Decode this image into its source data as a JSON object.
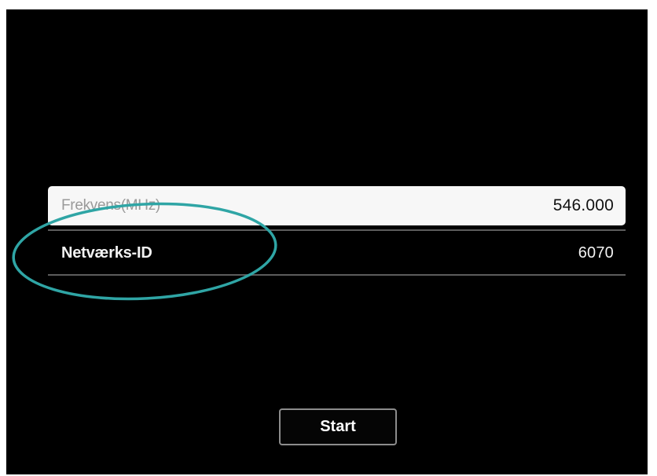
{
  "settings": {
    "frequency_label": "Frekvens(MHz)",
    "frequency_value": "546.000",
    "network_id_label": "Netværks-ID",
    "network_id_value": "6070"
  },
  "actions": {
    "start_label": "Start"
  },
  "colors": {
    "background": "#000000",
    "highlight_row": "#f7f7f7",
    "annotation_ellipse": "#2fa5a5"
  }
}
